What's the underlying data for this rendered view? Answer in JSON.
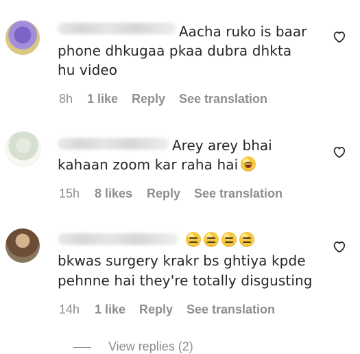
{
  "comments": [
    {
      "line1": "Aacha ruko is baar",
      "line2": "phone dhkugaa pkaa dubra dhkta",
      "line3": "hu video",
      "time": "8h",
      "likes": "1 like",
      "reply": "Reply",
      "translate": "See translation"
    },
    {
      "line1": "Arey arey bhai",
      "line2": "kahaan zoom kar raha hai",
      "time": "15h",
      "likes": "8 likes",
      "reply": "Reply",
      "translate": "See translation"
    },
    {
      "line2": "bkwas surgery krakr bs ghtiya kpde",
      "line3": "pehnne hai they're totally disgusting",
      "time": "14h",
      "likes": "1 like",
      "reply": "Reply",
      "translate": "See translation"
    }
  ],
  "view_replies": "View replies (2)",
  "icons": {
    "heart": "heart-outline-icon",
    "laugh_emoji": "face-with-tears-of-joy",
    "neutral_emoji": "expressionless-face"
  }
}
